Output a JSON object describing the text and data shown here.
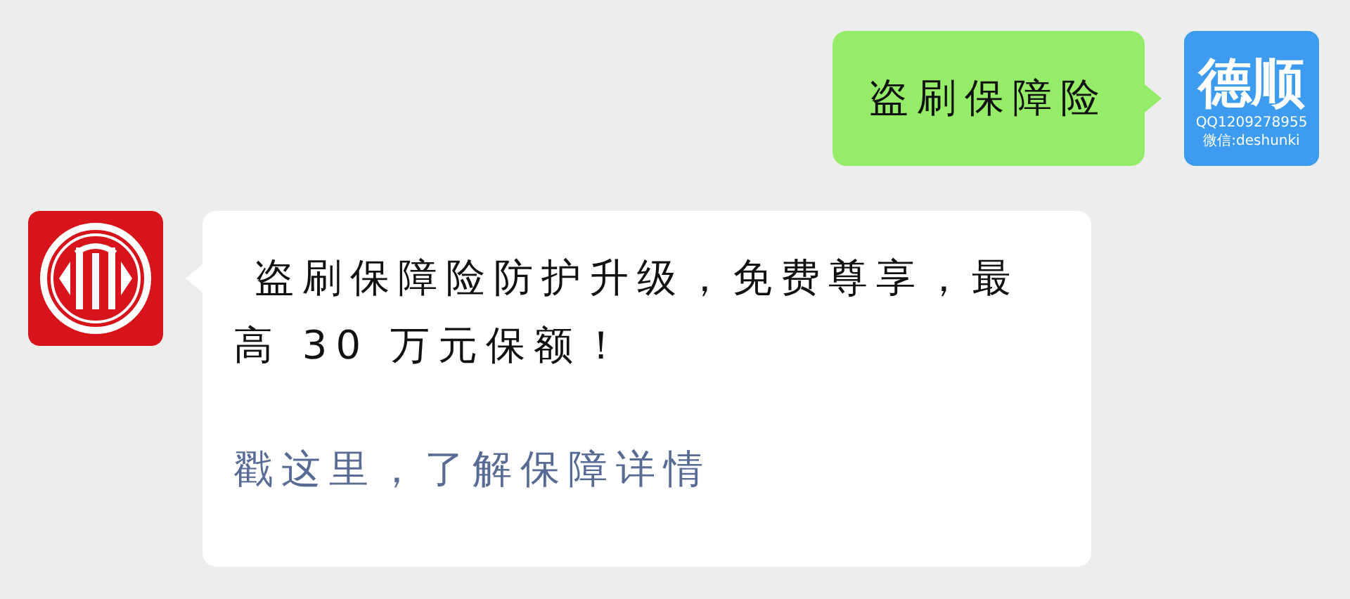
{
  "messages": [
    {
      "outgoing": true,
      "kind": "text",
      "text": "盗刷保障险",
      "avatar": {
        "kind": "text-avatar",
        "title": "德顺",
        "lines": [
          "QQ1209278955",
          "微信:deshunki"
        ]
      }
    },
    {
      "outgoing": false,
      "kind": "card",
      "text": " 盗刷保障险防护升级，免费尊享，最高 30 万元保额！",
      "link": "戳这里，了解保障详情",
      "avatar": {
        "kind": "logo"
      }
    }
  ]
}
